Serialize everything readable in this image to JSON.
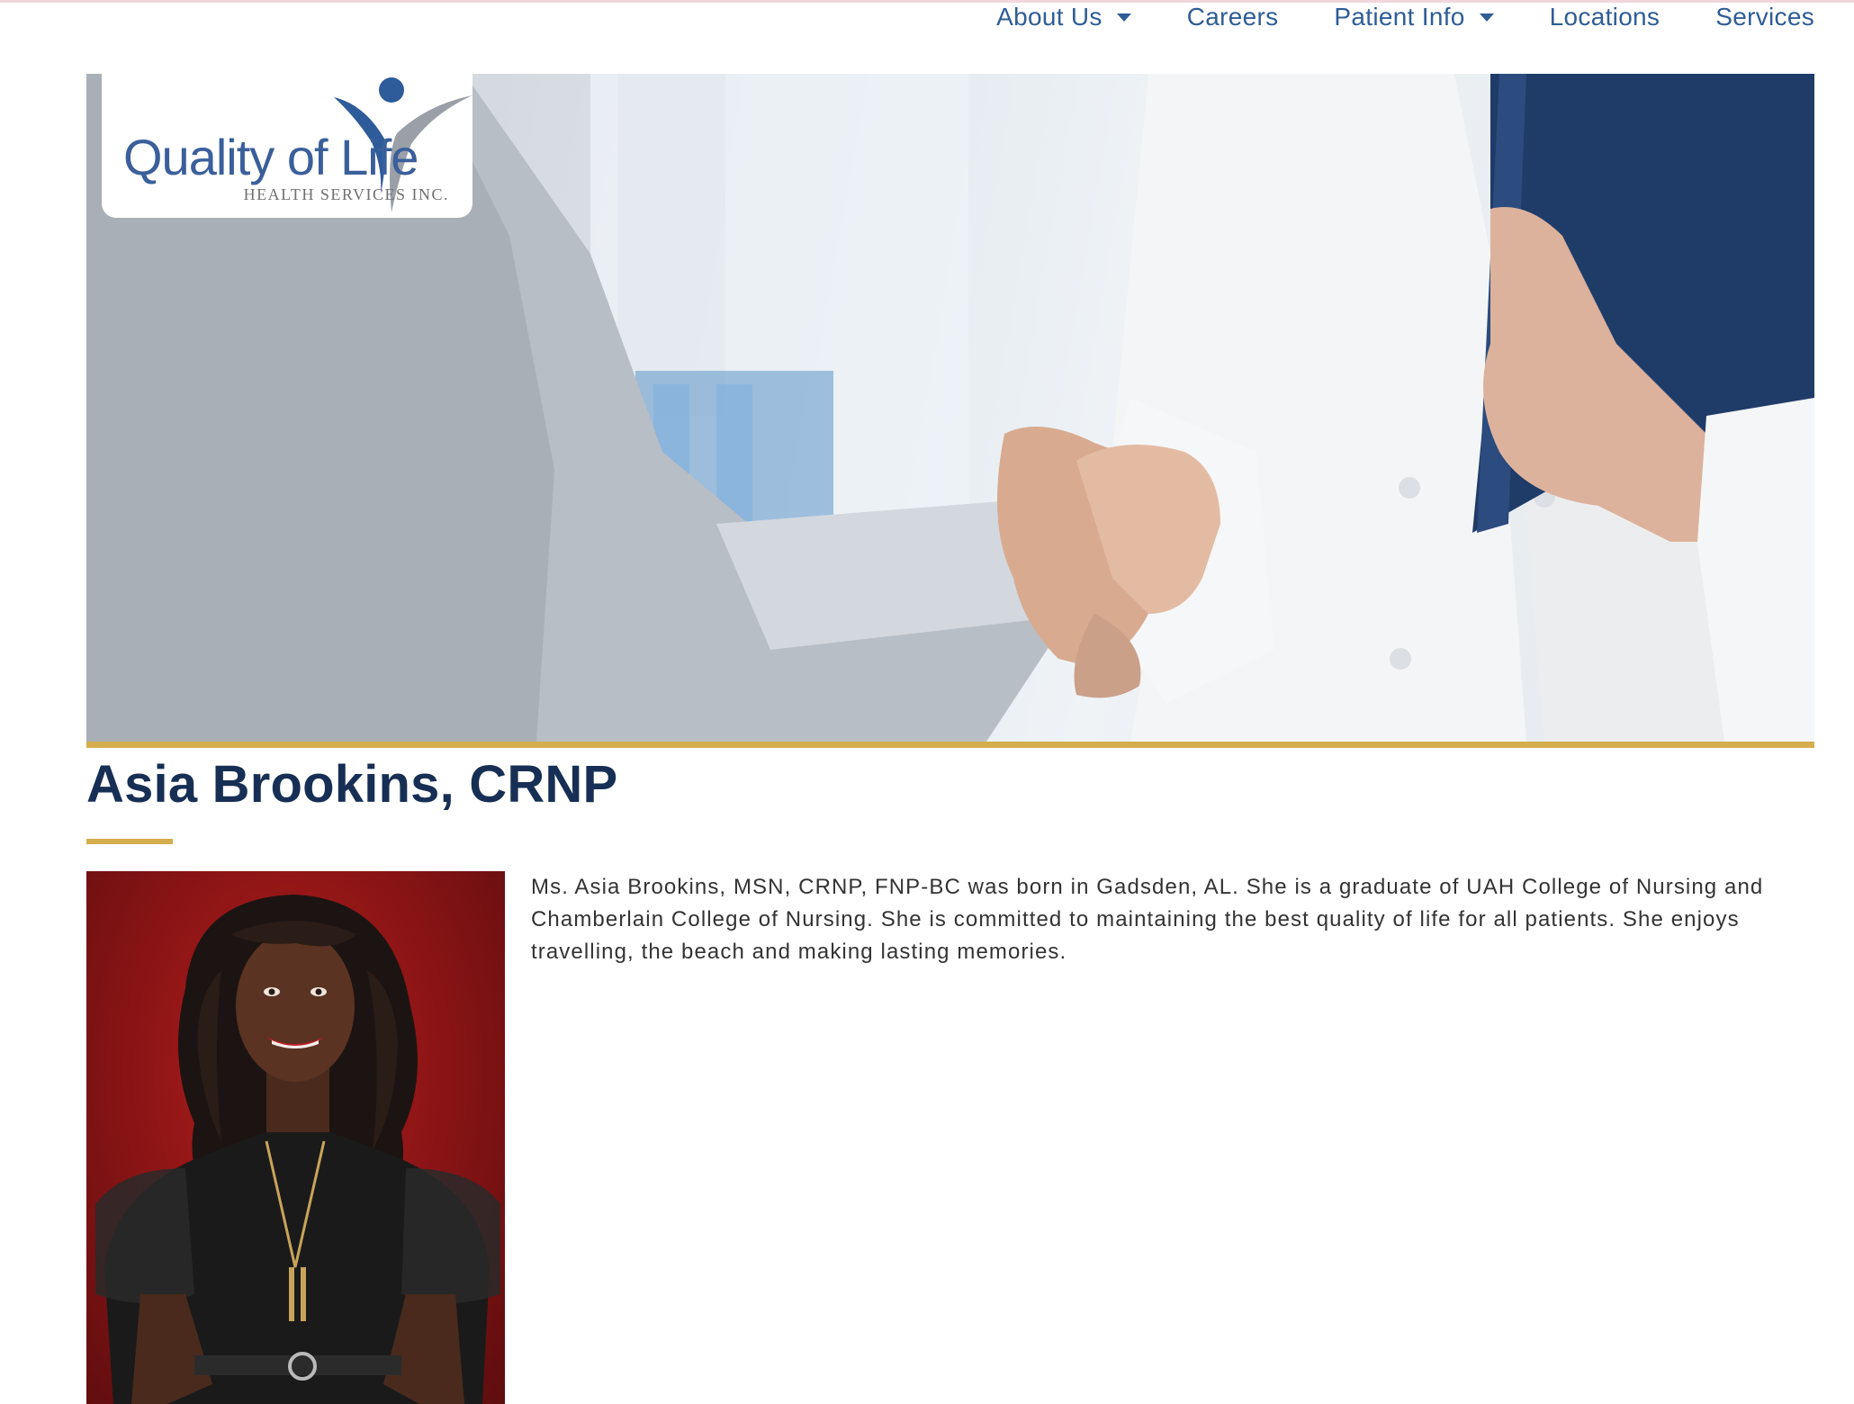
{
  "nav": {
    "items": [
      {
        "label": "About Us",
        "has_dropdown": true
      },
      {
        "label": "Careers",
        "has_dropdown": false
      },
      {
        "label": "Patient Info",
        "has_dropdown": true
      },
      {
        "label": "Locations",
        "has_dropdown": false
      },
      {
        "label": "Services",
        "has_dropdown": false
      }
    ]
  },
  "logo": {
    "wordmark": "Quality of Life",
    "subtitle": "HEALTH SERVICES INC.",
    "icon": "person-figure-icon"
  },
  "hero": {
    "icon": "handshake-image"
  },
  "profile": {
    "name": "Asia Brookins, CRNP",
    "bio": "Ms. Asia Brookins, MSN, CRNP, FNP-BC was born in Gadsden, AL. She is a graduate of UAH College of Nursing and Chamberlain College of Nursing. She is committed to maintaining the best quality of life for all patients. She enjoys travelling, the beach and making lasting memories.",
    "photo_icon": "portrait-photo"
  },
  "colors": {
    "nav_text": "#2f5d96",
    "title": "#172f54",
    "accent_gold": "#d4ad4c",
    "logo_blue": "#3a5f9b",
    "portrait_bg": "#a01a1a"
  }
}
